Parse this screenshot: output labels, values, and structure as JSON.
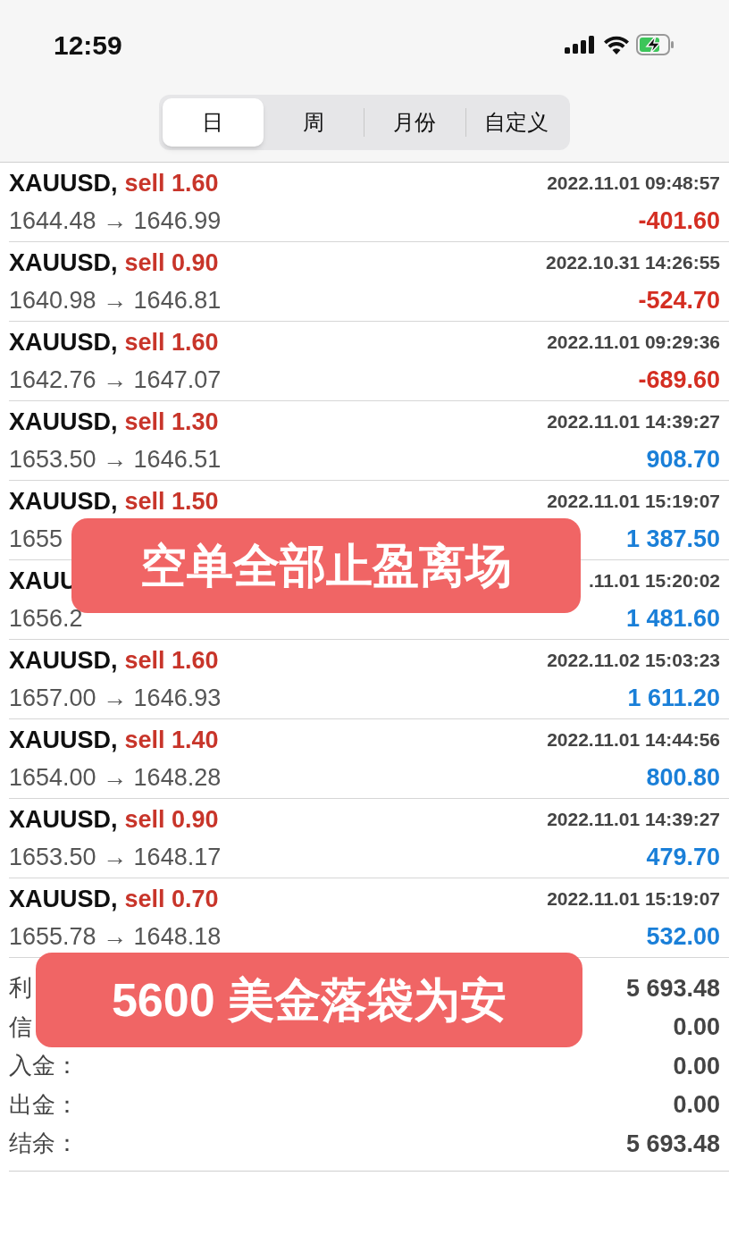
{
  "status_bar": {
    "time": "12:59"
  },
  "tabs": [
    {
      "label": "日",
      "selected": true
    },
    {
      "label": "周",
      "selected": false
    },
    {
      "label": "月份",
      "selected": false
    },
    {
      "label": "自定义",
      "selected": false
    }
  ],
  "trades": [
    {
      "symbol": "XAUUSD,",
      "order": "sell 1.60",
      "time": "2022.11.01 09:48:57",
      "prices": "1644.48 → 1646.99",
      "profit": "-401.60",
      "loss": true
    },
    {
      "symbol": "XAUUSD,",
      "order": "sell 0.90",
      "time": "2022.10.31 14:26:55",
      "prices": "1640.98 → 1646.81",
      "profit": "-524.70",
      "loss": true
    },
    {
      "symbol": "XAUUSD,",
      "order": "sell 1.60",
      "time": "2022.11.01 09:29:36",
      "prices": "1642.76 → 1647.07",
      "profit": "-689.60",
      "loss": true
    },
    {
      "symbol": "XAUUSD,",
      "order": "sell 1.30",
      "time": "2022.11.01 14:39:27",
      "prices": "1653.50 → 1646.51",
      "profit": "908.70",
      "loss": false
    },
    {
      "symbol": "XAUUSD,",
      "order": "sell 1.50",
      "time": "2022.11.01 15:19:07",
      "prices": "1655",
      "profit": "1 387.50",
      "loss": false
    },
    {
      "symbol": "XAUU",
      "time": ".11.01 15:20:02",
      "prices": "1656.2",
      "profit": "1 481.60",
      "loss": false
    },
    {
      "symbol": "XAUUSD,",
      "order": "sell 1.60",
      "time": "2022.11.02 15:03:23",
      "prices": "1657.00 → 1646.93",
      "profit": "1 611.20",
      "loss": false
    },
    {
      "symbol": "XAUUSD,",
      "order": "sell 1.40",
      "time": "2022.11.01 14:44:56",
      "prices": "1654.00 → 1648.28",
      "profit": "800.80",
      "loss": false
    },
    {
      "symbol": "XAUUSD,",
      "order": "sell 0.90",
      "time": "2022.11.01 14:39:27",
      "prices": "1653.50 → 1648.17",
      "profit": "479.70",
      "loss": false
    },
    {
      "symbol": "XAUUSD,",
      "order": "sell 0.70",
      "time": "2022.11.01 15:19:07",
      "prices": "1655.78 → 1648.18",
      "profit": "532.00",
      "loss": false
    }
  ],
  "summary": [
    {
      "label": "利",
      "value": "5 693.48"
    },
    {
      "label": "信",
      "value": "0.00"
    },
    {
      "label": "入金：",
      "value": "0.00"
    },
    {
      "label": "出金：",
      "value": "0.00"
    },
    {
      "label": "结余：",
      "value": "5 693.48"
    }
  ],
  "captions": [
    "空单全部止盈离场",
    "5600 美金落袋为安"
  ]
}
